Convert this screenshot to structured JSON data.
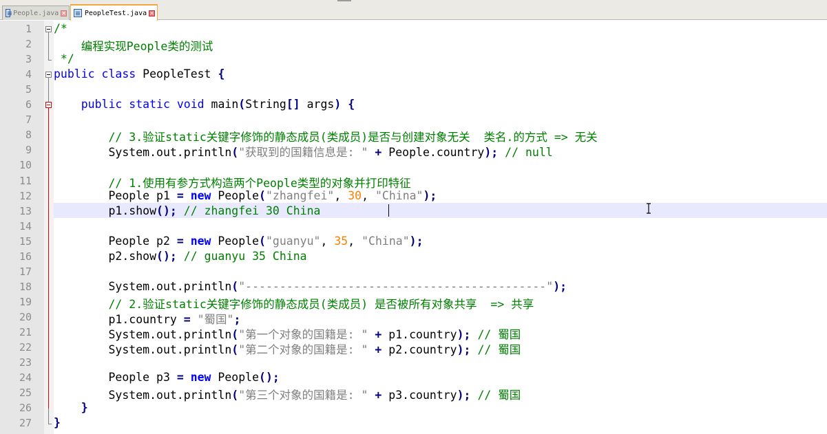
{
  "tabs": [
    {
      "label": "People.java",
      "active": false
    },
    {
      "label": "PeopleTest.java",
      "active": true
    }
  ],
  "colors": {
    "comment": "#008000",
    "keyword": "#0000ff",
    "string": "#808080",
    "number": "#ff8000",
    "operator": "#000080",
    "current_line": "#e8e8ff"
  },
  "editor": {
    "current_line": 13,
    "lines": [
      [
        {
          "t": "/*",
          "s": "c"
        }
      ],
      [
        {
          "t": "    编程实现People类的测试",
          "s": "c"
        }
      ],
      [
        {
          "t": " */",
          "s": "c"
        }
      ],
      [
        {
          "t": "public",
          "s": "k"
        },
        {
          "t": " "
        },
        {
          "t": "class",
          "s": "k"
        },
        {
          "t": " PeopleTest "
        },
        {
          "t": "{",
          "s": "o"
        }
      ],
      [],
      [
        {
          "t": "    "
        },
        {
          "t": "public",
          "s": "k"
        },
        {
          "t": " "
        },
        {
          "t": "static",
          "s": "k"
        },
        {
          "t": " "
        },
        {
          "t": "void",
          "s": "k"
        },
        {
          "t": " main"
        },
        {
          "t": "(",
          "s": "o"
        },
        {
          "t": "String"
        },
        {
          "t": "[]",
          "s": "o"
        },
        {
          "t": " args"
        },
        {
          "t": ")",
          "s": "o"
        },
        {
          "t": " "
        },
        {
          "t": "{",
          "s": "o"
        }
      ],
      [],
      [
        {
          "t": "        "
        },
        {
          "t": "// 3.验证static关键字修饰的静态成员(类成员)是否与创建对象无关  类名.的方式 => 无关",
          "s": "c"
        }
      ],
      [
        {
          "t": "        System.out.println"
        },
        {
          "t": "(",
          "s": "o"
        },
        {
          "t": "\"获取到的国籍信息是: \"",
          "s": "s"
        },
        {
          "t": " "
        },
        {
          "t": "+",
          "s": "o"
        },
        {
          "t": " People.country"
        },
        {
          "t": ");",
          "s": "o"
        },
        {
          "t": " "
        },
        {
          "t": "// null",
          "s": "c"
        }
      ],
      [],
      [
        {
          "t": "        "
        },
        {
          "t": "// 1.使用有参方式构造两个People类型的对象并打印特征",
          "s": "c"
        }
      ],
      [
        {
          "t": "        People p1 "
        },
        {
          "t": "=",
          "s": "o"
        },
        {
          "t": " "
        },
        {
          "t": "new",
          "s": "k-bold"
        },
        {
          "t": " People"
        },
        {
          "t": "(",
          "s": "o"
        },
        {
          "t": "\"zhangfei\"",
          "s": "s"
        },
        {
          "t": ", "
        },
        {
          "t": "30",
          "s": "n"
        },
        {
          "t": ", "
        },
        {
          "t": "\"China\"",
          "s": "s"
        },
        {
          "t": ");",
          "s": "o"
        }
      ],
      [
        {
          "t": "        p1.show"
        },
        {
          "t": "();",
          "s": "o"
        },
        {
          "t": " "
        },
        {
          "t": "// zhangfei 30 China",
          "s": "c"
        }
      ],
      [],
      [
        {
          "t": "        People p2 "
        },
        {
          "t": "=",
          "s": "o"
        },
        {
          "t": " "
        },
        {
          "t": "new",
          "s": "k-bold"
        },
        {
          "t": " People"
        },
        {
          "t": "(",
          "s": "o"
        },
        {
          "t": "\"guanyu\"",
          "s": "s"
        },
        {
          "t": ", "
        },
        {
          "t": "35",
          "s": "n"
        },
        {
          "t": ", "
        },
        {
          "t": "\"China\"",
          "s": "s"
        },
        {
          "t": ");",
          "s": "o"
        }
      ],
      [
        {
          "t": "        p2.show"
        },
        {
          "t": "();",
          "s": "o"
        },
        {
          "t": " "
        },
        {
          "t": "// guanyu 35 China",
          "s": "c"
        }
      ],
      [],
      [
        {
          "t": "        System.out.println"
        },
        {
          "t": "(",
          "s": "o"
        },
        {
          "t": "\"--------------------------------------------\"",
          "s": "s"
        },
        {
          "t": ");",
          "s": "o"
        }
      ],
      [
        {
          "t": "        "
        },
        {
          "t": "// 2.验证static关键字修饰的静态成员(类成员) 是否被所有对象共享  => 共享",
          "s": "c"
        }
      ],
      [
        {
          "t": "        p1.country "
        },
        {
          "t": "=",
          "s": "o"
        },
        {
          "t": " "
        },
        {
          "t": "\"蜀国\"",
          "s": "s"
        },
        {
          "t": ";",
          "s": "o"
        }
      ],
      [
        {
          "t": "        System.out.println"
        },
        {
          "t": "(",
          "s": "o"
        },
        {
          "t": "\"第一个对象的国籍是: \"",
          "s": "s"
        },
        {
          "t": " "
        },
        {
          "t": "+",
          "s": "o"
        },
        {
          "t": " p1.country"
        },
        {
          "t": ");",
          "s": "o"
        },
        {
          "t": " "
        },
        {
          "t": "// 蜀国",
          "s": "c"
        }
      ],
      [
        {
          "t": "        System.out.println"
        },
        {
          "t": "(",
          "s": "o"
        },
        {
          "t": "\"第二个对象的国籍是: \"",
          "s": "s"
        },
        {
          "t": " "
        },
        {
          "t": "+",
          "s": "o"
        },
        {
          "t": " p2.country"
        },
        {
          "t": ");",
          "s": "o"
        },
        {
          "t": " "
        },
        {
          "t": "// 蜀国",
          "s": "c"
        }
      ],
      [],
      [
        {
          "t": "        People p3 "
        },
        {
          "t": "=",
          "s": "o"
        },
        {
          "t": " "
        },
        {
          "t": "new",
          "s": "k-bold"
        },
        {
          "t": " People"
        },
        {
          "t": "();",
          "s": "o"
        }
      ],
      [
        {
          "t": "        System.out.println"
        },
        {
          "t": "(",
          "s": "o"
        },
        {
          "t": "\"第三个对象的国籍是: \"",
          "s": "s"
        },
        {
          "t": " "
        },
        {
          "t": "+",
          "s": "o"
        },
        {
          "t": " p3.country"
        },
        {
          "t": ");",
          "s": "o"
        },
        {
          "t": " "
        },
        {
          "t": "// 蜀国",
          "s": "c"
        }
      ],
      [
        {
          "t": "    "
        },
        {
          "t": "}",
          "s": "o"
        }
      ],
      [
        {
          "t": "}",
          "s": "o"
        }
      ]
    ]
  }
}
